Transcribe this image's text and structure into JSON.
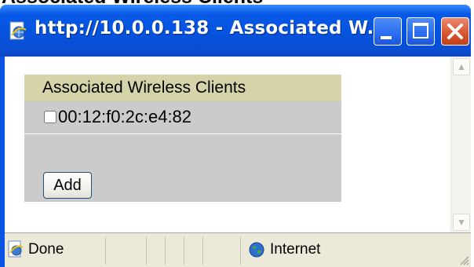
{
  "page": {
    "heading": "Associated Wireless Clients"
  },
  "window": {
    "title": "http://10.0.0.138 - Associated W..."
  },
  "panel": {
    "header": "Associated Wireless Clients",
    "clients": [
      {
        "mac": "00:12:f0:2c:e4:82",
        "checked": false
      }
    ],
    "add_label": "Add"
  },
  "statusbar": {
    "status": "Done",
    "zone": "Internet"
  },
  "icons": {
    "title": "ie-page-icon",
    "status": "ie-page-icon",
    "zone": "globe-icon"
  },
  "colors": {
    "titlebar": "#0554e0",
    "panel_header": "#d6d3a8",
    "panel_body": "#cbcbcb",
    "statusbar": "#ece9d8"
  }
}
